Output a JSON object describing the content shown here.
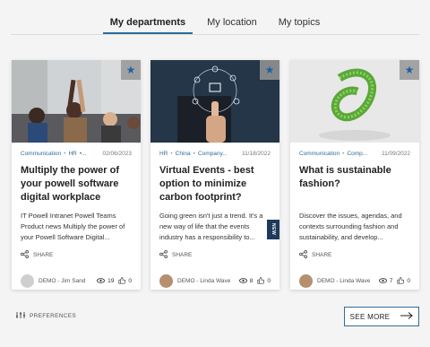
{
  "tabs": [
    {
      "label": "My departments"
    },
    {
      "label": "My location"
    },
    {
      "label": "My topics"
    }
  ],
  "cards": [
    {
      "tags": [
        "Communication",
        "HR",
        "•..."
      ],
      "date": "02/06/2023",
      "title": "Multiply the power of your powell software digital workplace usin...",
      "excerpt": "IT Powell Intranet Powell Teams Product news Multiply the power of your Powell Software Digital...",
      "share": "SHARE",
      "author": "DEMO - Jim Sand",
      "views": "19",
      "likes": "0"
    },
    {
      "tags": [
        "HR",
        "China",
        "Company..."
      ],
      "date": "11/18/2022",
      "title": "Virtual Events - best option to minimize carbon footprint?",
      "excerpt": "Going green isn't just a trend. It's a new way of life that the events industry has a responsibility to...",
      "share": "SHARE",
      "author": "DEMO - Linda Wave",
      "views": "8",
      "likes": "0",
      "badge": "NEW"
    },
    {
      "tags": [
        "Communication",
        "Comp..."
      ],
      "date": "11/09/2022",
      "title": "What is sustainable fashion?",
      "excerpt": "Discover the issues, agendas, and contexts surrounding fashion and sustainability, and develop...",
      "share": "SHARE",
      "author": "DEMO - Linda Wave",
      "views": "7",
      "likes": "0"
    }
  ],
  "preferences_label": "PREFERENCES",
  "see_more_label": "SEE MORE",
  "colors": {
    "accent": "#2f6c9a",
    "star": "#1f5fa6",
    "badge": "#1e3a5c"
  }
}
